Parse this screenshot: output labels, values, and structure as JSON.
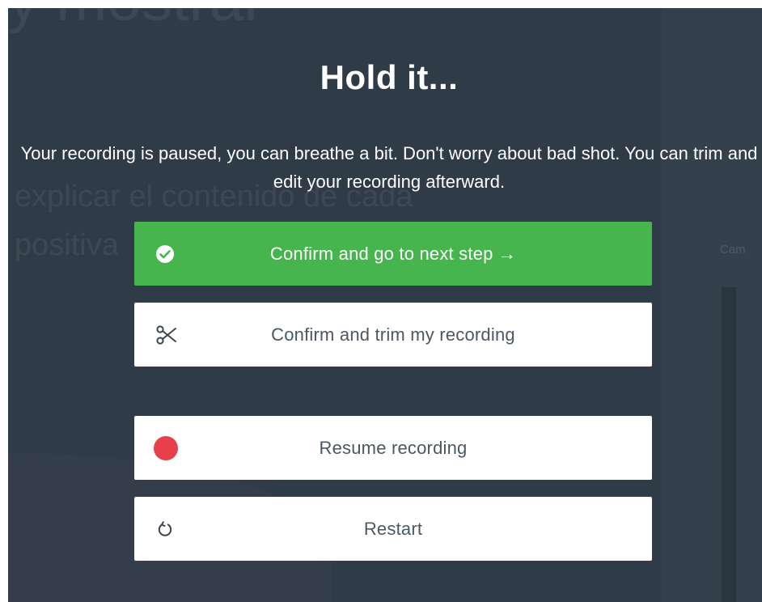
{
  "background": {
    "heading_fragment": "y mostrar",
    "line1": "explicar el contenido de cada",
    "line2": "positiva",
    "side_label": "Cam"
  },
  "modal": {
    "title": "Hold it...",
    "message": "Your recording is paused, you can breathe a bit. Don't worry about bad shot. You can trim and edit your recording afterward.",
    "buttons": {
      "next": {
        "label": "Confirm and go to next step →",
        "icon": "check-circle-icon"
      },
      "trim": {
        "label": "Confirm and trim my recording",
        "icon": "scissors-icon"
      },
      "resume": {
        "label": "Resume recording",
        "icon": "record-dot-icon"
      },
      "restart": {
        "label": "Restart",
        "icon": "restart-icon"
      }
    }
  },
  "colors": {
    "overlay": "#2f3b47",
    "primary": "#46b54e",
    "record": "#e8404a",
    "button_text": "#4d5761"
  }
}
